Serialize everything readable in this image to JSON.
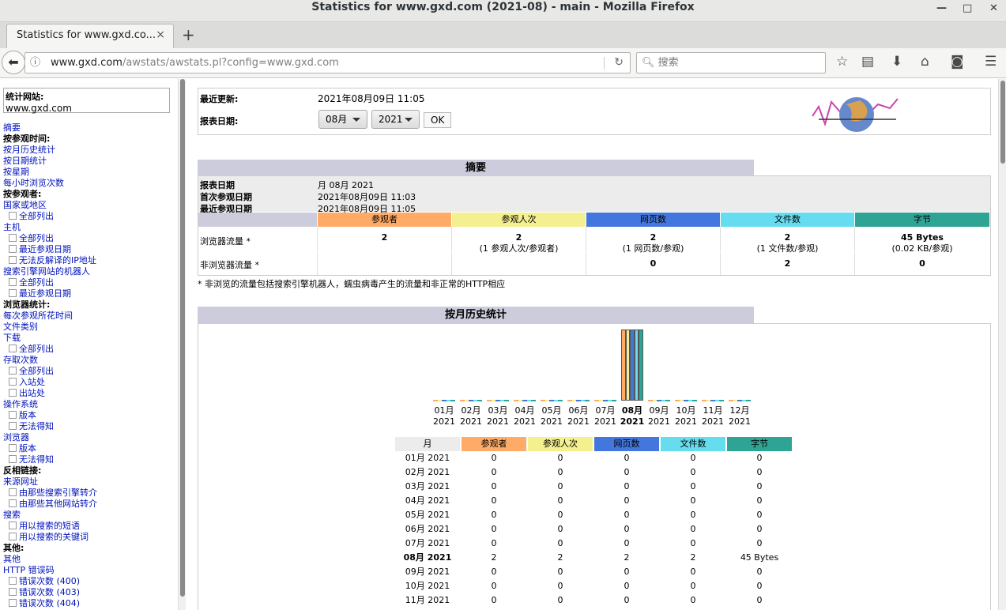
{
  "window": {
    "title": "Statistics for www.gxd.com (2021-08) - main - Mozilla Firefox"
  },
  "tab": {
    "label": "Statistics for www.gxd.co...",
    "close": "×"
  },
  "nav": {
    "url_host": "www.gxd.com",
    "url_path": "/awstats/awstats.pl?config=www.gxd.com",
    "search_placeholder": "搜索"
  },
  "sidebar": {
    "site_label": "统计网站:",
    "site_value": "www.gxd.com",
    "items": [
      {
        "t": "link",
        "label": "摘要"
      },
      {
        "t": "hdr",
        "label": "按参观时间:"
      },
      {
        "t": "link",
        "label": "按月历史统计"
      },
      {
        "t": "link",
        "label": "按日期统计"
      },
      {
        "t": "link",
        "label": "按星期"
      },
      {
        "t": "link",
        "label": "每小时浏览次数"
      },
      {
        "t": "hdr",
        "label": "按参观者:"
      },
      {
        "t": "link",
        "label": "国家或地区"
      },
      {
        "t": "sub",
        "label": "全部列出"
      },
      {
        "t": "link",
        "label": "主机"
      },
      {
        "t": "sub",
        "label": "全部列出"
      },
      {
        "t": "sub",
        "label": "最近参观日期"
      },
      {
        "t": "sub",
        "label": "无法反解译的IP地址"
      },
      {
        "t": "link",
        "label": "搜索引擎网站的机器人"
      },
      {
        "t": "sub",
        "label": "全部列出"
      },
      {
        "t": "sub",
        "label": "最近参观日期"
      },
      {
        "t": "hdr",
        "label": "浏览器统计:"
      },
      {
        "t": "link",
        "label": "每次参观所花时间"
      },
      {
        "t": "link",
        "label": "文件类别"
      },
      {
        "t": "link",
        "label": "下载"
      },
      {
        "t": "sub",
        "label": "全部列出"
      },
      {
        "t": "link",
        "label": "存取次数"
      },
      {
        "t": "sub",
        "label": "全部列出"
      },
      {
        "t": "sub",
        "label": "入站处"
      },
      {
        "t": "sub",
        "label": "出站处"
      },
      {
        "t": "link",
        "label": "操作系统"
      },
      {
        "t": "sub",
        "label": "版本"
      },
      {
        "t": "sub",
        "label": "无法得知"
      },
      {
        "t": "link",
        "label": "浏览器"
      },
      {
        "t": "sub",
        "label": "版本"
      },
      {
        "t": "sub",
        "label": "无法得知"
      },
      {
        "t": "hdr",
        "label": "反相链接:"
      },
      {
        "t": "link",
        "label": "来源网址"
      },
      {
        "t": "sub",
        "label": "由那些搜索引擎转介"
      },
      {
        "t": "sub",
        "label": "由那些其他网站转介"
      },
      {
        "t": "link",
        "label": "搜索"
      },
      {
        "t": "sub",
        "label": "用以搜索的短语"
      },
      {
        "t": "sub",
        "label": "用以搜索的关键词"
      },
      {
        "t": "hdr",
        "label": "其他:"
      },
      {
        "t": "link",
        "label": "其他"
      },
      {
        "t": "link",
        "label": "HTTP 错误码"
      },
      {
        "t": "sub",
        "label": "错误次数 (400)"
      },
      {
        "t": "sub",
        "label": "错误次数 (403)"
      },
      {
        "t": "sub",
        "label": "错误次数 (404)"
      }
    ]
  },
  "header": {
    "last_update_label": "最近更新:",
    "last_update_value": "2021年08月09日 11:05",
    "report_date_label": "报表日期:",
    "month_select": "08月",
    "year_select": "2021",
    "ok_label": "OK"
  },
  "summary": {
    "title": "摘要",
    "rows": [
      {
        "label": "报表日期",
        "value": "月 08月 2021"
      },
      {
        "label": "首次参观日期",
        "value": "2021年08月09日 11:03"
      },
      {
        "label": "最近参观日期",
        "value": "2021年08月09日 11:05"
      }
    ],
    "columns": [
      "参观者",
      "参观人次",
      "网页数",
      "文件数",
      "字节"
    ],
    "column_colors": [
      "#FFAA66",
      "#F4F090",
      "#4477DD",
      "#66DDEE",
      "#2EA495"
    ],
    "browser_label": "浏览器流量 *",
    "browser_values": [
      "2",
      "2",
      "2",
      "2",
      "45 Bytes"
    ],
    "browser_subs": [
      "",
      "(1 参观人次/参观者)",
      "(1 网页数/参观)",
      "(1 文件数/参观)",
      "(0.02 KB/参观)"
    ],
    "nonbrowser_label": "非浏览器流量 *",
    "nonbrowser_values": [
      "",
      "",
      "0",
      "2",
      "0"
    ],
    "note": "* 非浏览的流量包括搜索引擎机器人，蠕虫病毒产生的流量和非正常的HTTP相应"
  },
  "monthly": {
    "title": "按月历史统计",
    "table_month_header": "月",
    "rows": [
      {
        "month": "01月 2021",
        "v": [
          "0",
          "0",
          "0",
          "0",
          "0"
        ],
        "bold": false
      },
      {
        "month": "02月 2021",
        "v": [
          "0",
          "0",
          "0",
          "0",
          "0"
        ],
        "bold": false
      },
      {
        "month": "03月 2021",
        "v": [
          "0",
          "0",
          "0",
          "0",
          "0"
        ],
        "bold": false
      },
      {
        "month": "04月 2021",
        "v": [
          "0",
          "0",
          "0",
          "0",
          "0"
        ],
        "bold": false
      },
      {
        "month": "05月 2021",
        "v": [
          "0",
          "0",
          "0",
          "0",
          "0"
        ],
        "bold": false
      },
      {
        "month": "06月 2021",
        "v": [
          "0",
          "0",
          "0",
          "0",
          "0"
        ],
        "bold": false
      },
      {
        "month": "07月 2021",
        "v": [
          "0",
          "0",
          "0",
          "0",
          "0"
        ],
        "bold": false
      },
      {
        "month": "08月 2021",
        "v": [
          "2",
          "2",
          "2",
          "2",
          "45 Bytes"
        ],
        "bold": true
      },
      {
        "month": "09月 2021",
        "v": [
          "0",
          "0",
          "0",
          "0",
          "0"
        ],
        "bold": false
      },
      {
        "month": "10月 2021",
        "v": [
          "0",
          "0",
          "0",
          "0",
          "0"
        ],
        "bold": false
      },
      {
        "month": "11月 2021",
        "v": [
          "0",
          "0",
          "0",
          "0",
          "0"
        ],
        "bold": false
      }
    ]
  },
  "chart_data": {
    "type": "bar",
    "categories": [
      "01月",
      "02月",
      "03月",
      "04月",
      "05月",
      "06月",
      "07月",
      "08月",
      "09月",
      "10月",
      "11月",
      "12月"
    ],
    "year_labels": [
      "2021",
      "2021",
      "2021",
      "2021",
      "2021",
      "2021",
      "2021",
      "2021",
      "2021",
      "2021",
      "2021",
      "2021"
    ],
    "highlight": "08月",
    "series": [
      {
        "name": "参观者",
        "color": "#FFAA66",
        "values": [
          0,
          0,
          0,
          0,
          0,
          0,
          0,
          2,
          0,
          0,
          0,
          0
        ]
      },
      {
        "name": "参观人次",
        "color": "#F4F090",
        "values": [
          0,
          0,
          0,
          0,
          0,
          0,
          0,
          2,
          0,
          0,
          0,
          0
        ]
      },
      {
        "name": "网页数",
        "color": "#4477DD",
        "values": [
          0,
          0,
          0,
          0,
          0,
          0,
          0,
          2,
          0,
          0,
          0,
          0
        ]
      },
      {
        "name": "文件数",
        "color": "#66DDEE",
        "values": [
          0,
          0,
          0,
          0,
          0,
          0,
          0,
          2,
          0,
          0,
          0,
          0
        ]
      },
      {
        "name": "字节",
        "color": "#2EA495",
        "values": [
          0,
          0,
          0,
          0,
          0,
          0,
          0,
          45,
          0,
          0,
          0,
          0
        ]
      }
    ]
  }
}
